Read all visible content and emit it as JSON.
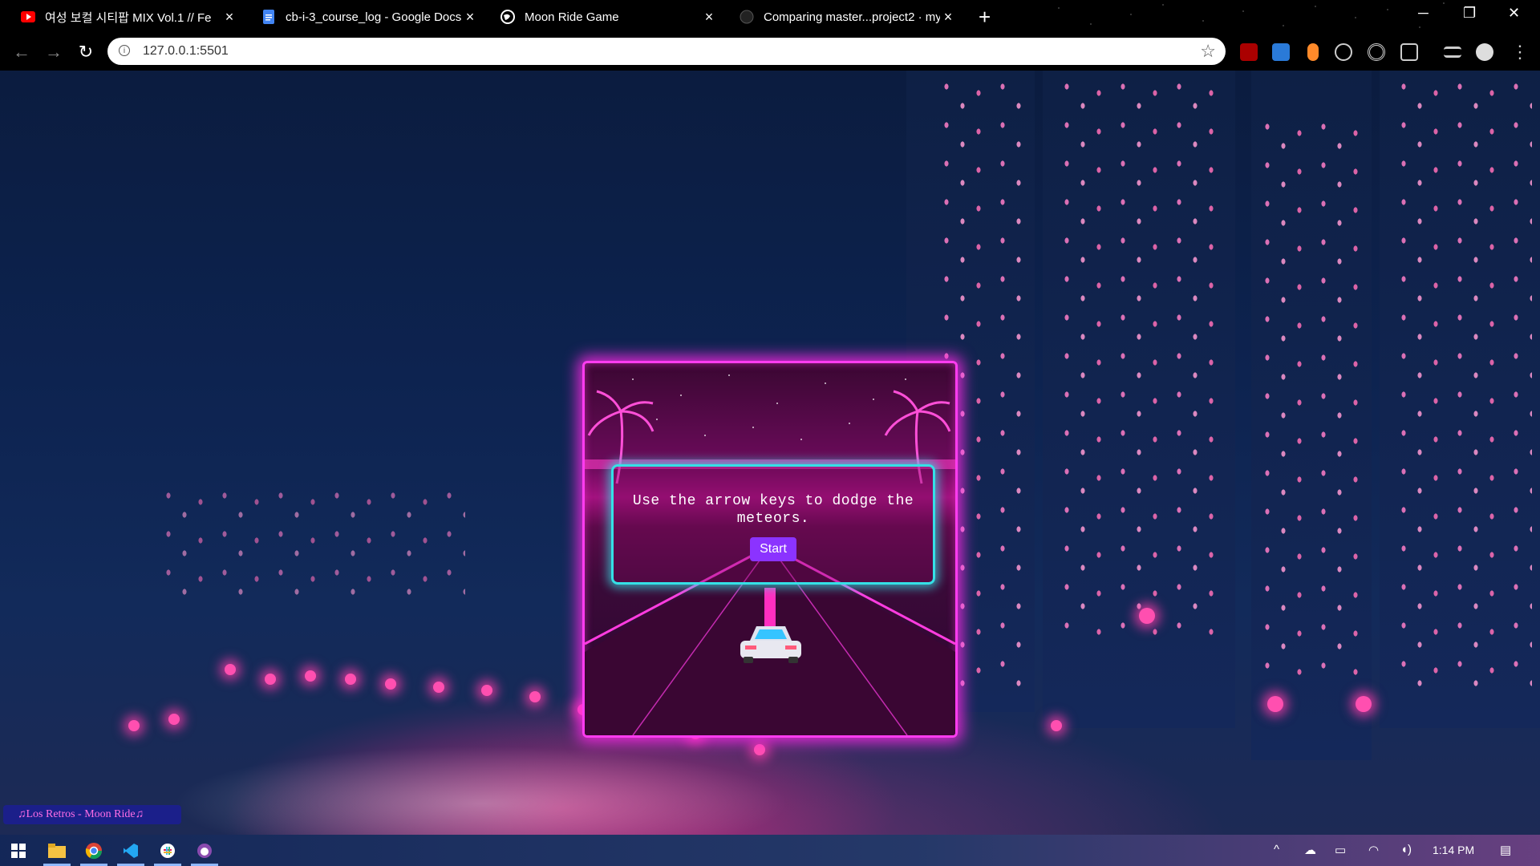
{
  "browser": {
    "tabs": [
      {
        "title": "여성 보컬 시티팝 MIX Vol.1 // Fe",
        "icon": "youtube-icon",
        "active": false
      },
      {
        "title": "cb-i-3_course_log - Google Docs",
        "icon": "google-docs-icon",
        "active": false
      },
      {
        "title": "Moon Ride Game",
        "icon": "globe-icon",
        "active": true
      },
      {
        "title": "Comparing master...project2 · my",
        "icon": "github-icon",
        "active": false
      }
    ],
    "new_tab_glyph": "+",
    "url": "127.0.0.1:5501"
  },
  "game": {
    "message": "Use the arrow keys to dodge the meteors.",
    "start_label": "Start"
  },
  "music": {
    "track_label": "♫Los Retros - Moon Ride♫"
  },
  "taskbar": {
    "time": "1:14 PM"
  }
}
